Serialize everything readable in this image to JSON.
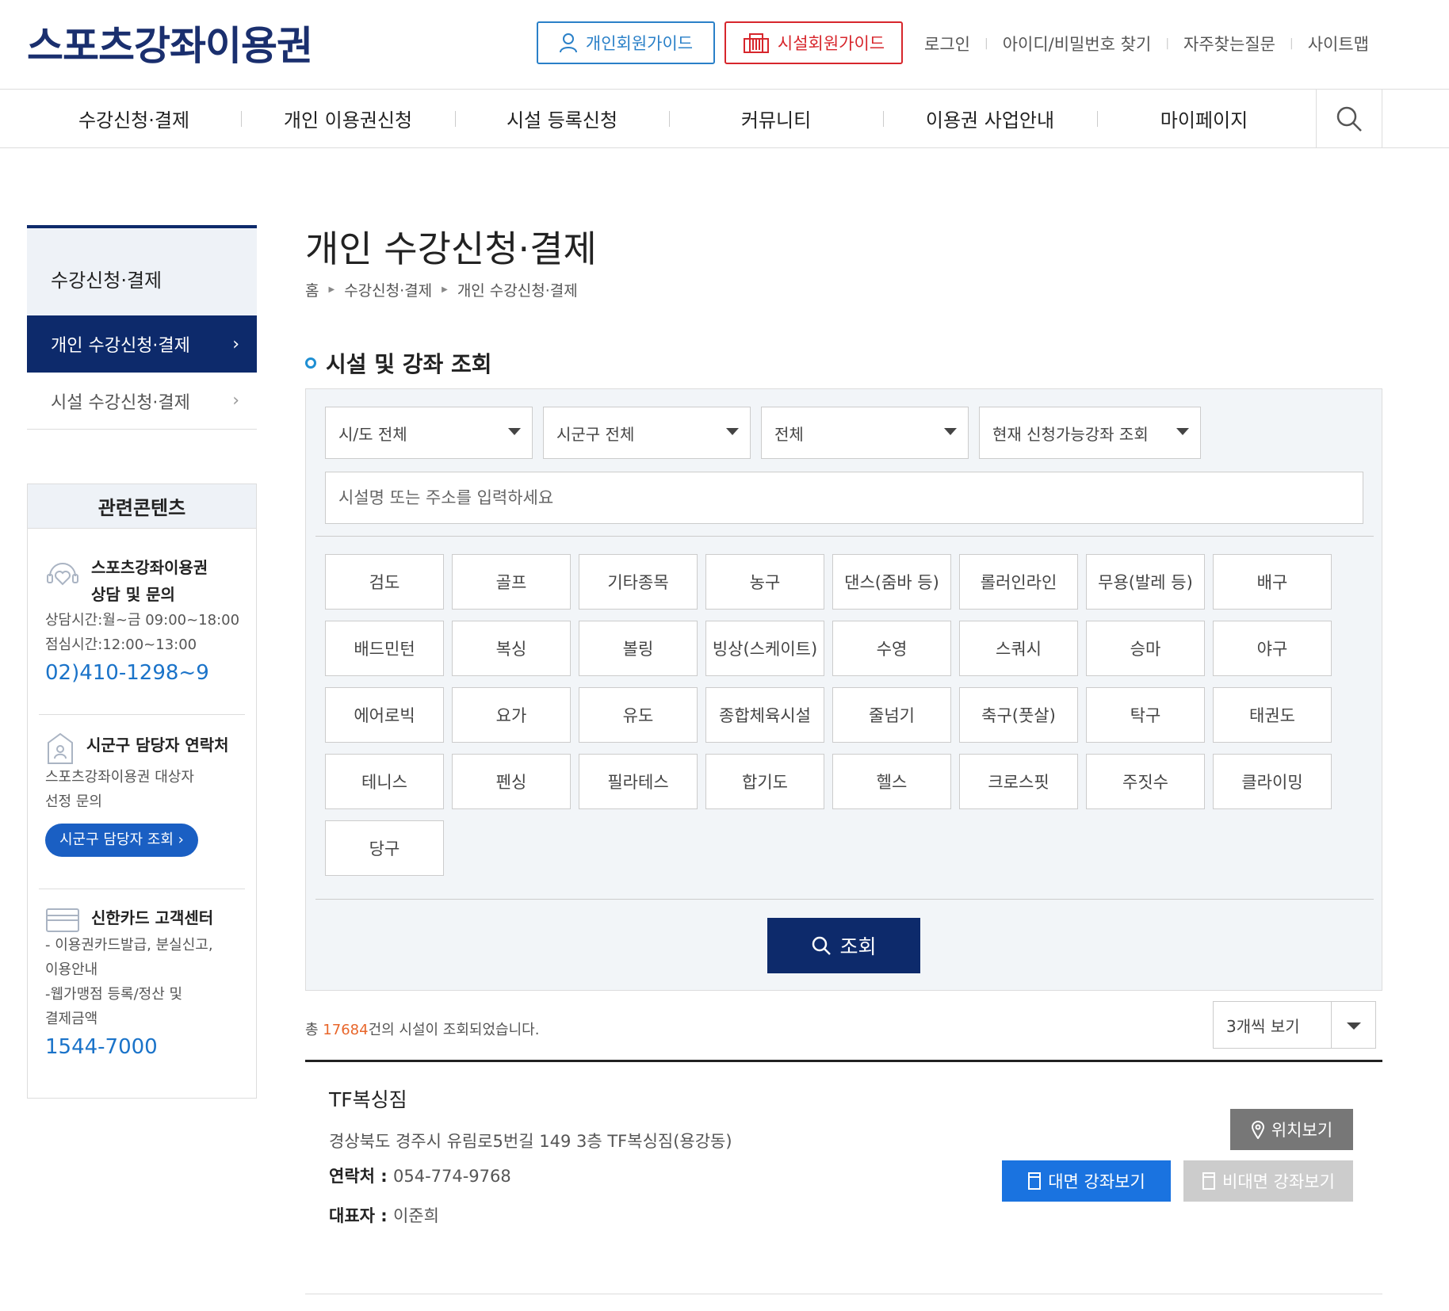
{
  "header": {
    "logo": "스포츠강좌이용권",
    "guide_personal": "개인회원가이드",
    "guide_facility": "시설회원가이드",
    "links": [
      "로그인",
      "아이디/비밀번호 찾기",
      "자주찾는질문",
      "사이트맵"
    ]
  },
  "gnb": [
    "수강신청·결제",
    "개인 이용권신청",
    "시설 등록신청",
    "커뮤니티",
    "이용권 사업안내",
    "마이페이지"
  ],
  "lnb": {
    "title": "수강신청·결제",
    "items": [
      "개인 수강신청·결제",
      "시설 수강신청·결제"
    ]
  },
  "related": {
    "title": "관련콘텐츠",
    "consult_title_1": "스포츠강좌이용권",
    "consult_title_2": "상담 및 문의",
    "consult_hours": "상담시간:월~금 09:00~18:00",
    "lunch_hours": "점심시간:12:00~13:00",
    "consult_phone": "02)410-1298~9",
    "district_title": "시군구 담당자 연락처",
    "district_desc_1": "스포츠강좌이용권 대상자",
    "district_desc_2": "선정 문의",
    "district_button": "시군구 담당자 조회",
    "card_title": "신한카드 고객센터",
    "card_desc_1": "- 이용권카드발급, 분실신고,",
    "card_desc_2": "이용안내",
    "card_desc_3": "-웹가맹점 등록/정산 및",
    "card_desc_4": "결제금액",
    "card_phone": "1544-7000"
  },
  "page": {
    "title": "개인 수강신청·결제",
    "breadcrumb": [
      "홈",
      "수강신청·결제",
      "개인 수강신청·결제"
    ],
    "section_title": "시설 및 강좌 조회"
  },
  "search": {
    "selects": [
      "시/도 전체",
      "시군구 전체",
      "전체",
      "현재 신청가능강좌 조회"
    ],
    "placeholder": "시설명 또는 주소를 입력하세요",
    "sports": [
      "검도",
      "골프",
      "기타종목",
      "농구",
      "댄스(줌바 등)",
      "롤러인라인",
      "무용(발레 등)",
      "배구",
      "배드민턴",
      "복싱",
      "볼링",
      "빙상(스케이트)",
      "수영",
      "스쿼시",
      "승마",
      "야구",
      "에어로빅",
      "요가",
      "유도",
      "종합체육시설",
      "줄넘기",
      "축구(풋살)",
      "탁구",
      "태권도",
      "테니스",
      "펜싱",
      "필라테스",
      "합기도",
      "헬스",
      "크로스핏",
      "주짓수",
      "클라이밍",
      "당구"
    ],
    "submit": "조회"
  },
  "results": {
    "prefix": "총 ",
    "count": "17684",
    "suffix": "건의 시설이 조회되었습니다.",
    "view_option": "3개씩 보기"
  },
  "facility": {
    "name": "TF복싱짐",
    "address": "경상북도 경주시 유림로5번길 149 3층 TF복싱짐(용강동)",
    "contact_label": "연락처 : ",
    "contact": "054-774-9768",
    "rep_label": "대표자 : ",
    "rep": "이준희",
    "location_button": "위치보기",
    "face_button": "대면 강좌보기",
    "nonface_button": "비대면 강좌보기"
  }
}
